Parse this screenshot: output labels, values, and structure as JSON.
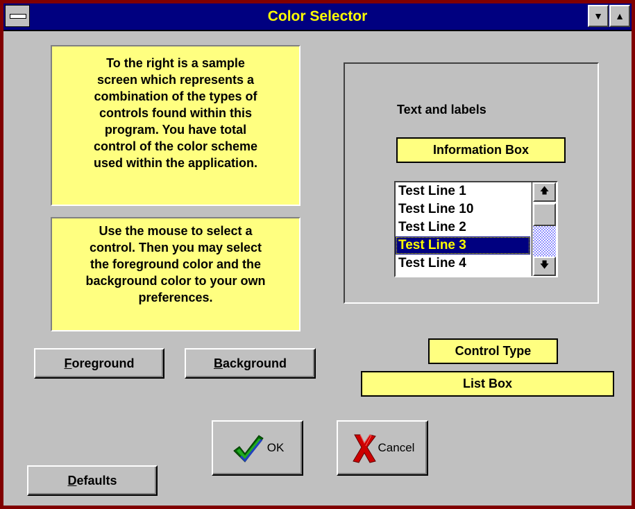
{
  "window": {
    "title": "Color Selector",
    "system_menu_icon": "system-menu-icon",
    "minimize_icon": "minimize-arrow-icon",
    "maximize_icon": "maximize-arrow-icon"
  },
  "info": {
    "description": "To the right is a sample\nscreen which represents a\ncombination of the types of\ncontrols found within this\nprogram.  You have total\ncontrol of the color scheme\nused within the application.",
    "instructions": "Use the mouse to select a\ncontrol.  Then you may select\nthe foreground color and the\nbackground color to your own\npreferences."
  },
  "buttons": {
    "foreground": {
      "accel": "F",
      "rest": "oreground"
    },
    "background": {
      "accel": "B",
      "rest": "ackground"
    },
    "defaults": {
      "accel": "D",
      "rest": "efaults"
    },
    "ok": "OK",
    "cancel": "Cancel"
  },
  "sample": {
    "text_label": "Text and labels",
    "information_box": "Information Box",
    "list_items": [
      "Test Line 1",
      "Test Line 10",
      "Test Line 2",
      "Test Line 3",
      "Test Line 4"
    ],
    "selected_index": 3
  },
  "control": {
    "type_label": "Control Type",
    "type_value": "List Box"
  },
  "colors": {
    "frame": "#800000",
    "titlebar": "#000080",
    "title_text": "#ffff00",
    "window_bg": "#c0c0c0",
    "info_bg": "#ffff80",
    "selection_bg": "#000080",
    "selection_text": "#ffff00"
  }
}
